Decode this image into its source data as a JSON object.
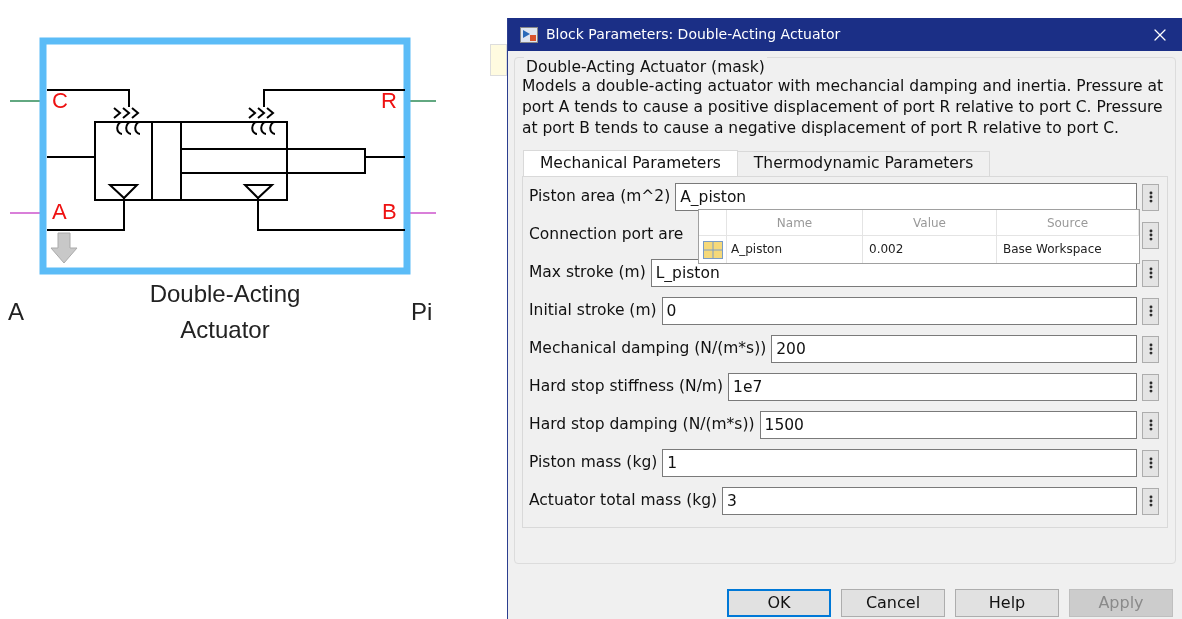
{
  "diagram": {
    "ports": [
      {
        "label": "C"
      },
      {
        "label": "R"
      },
      {
        "label": "A"
      },
      {
        "label": "B"
      }
    ],
    "block_label": "Double-Acting Actuator",
    "neighbor_labels": [
      "A",
      "Pi"
    ]
  },
  "dialog": {
    "title": "Block Parameters: Double-Acting Actuator",
    "group_title": "Double-Acting Actuator (mask)",
    "description": "Models a double-acting actuator with mechancial damping and inertia. Pressure at port A tends to cause a positive displacement of port R relative to port C. Pressure at port B tends to cause a negative displacement of port R relative to port C.",
    "tabs": [
      {
        "label": "Mechanical Parameters",
        "selected": true
      },
      {
        "label": "Thermodynamic Parameters",
        "selected": false
      }
    ],
    "parameters": [
      {
        "label": "Piston area (m^2)",
        "value": "A_piston"
      },
      {
        "label": "Connection port are"
      },
      {
        "label": "Max stroke (m)",
        "value": "L_piston"
      },
      {
        "label": "Initial stroke (m)",
        "value": "0"
      },
      {
        "label": "Mechanical damping (N/(m*s))",
        "value": "200"
      },
      {
        "label": "Hard stop stiffness (N/m)",
        "value": "1e7"
      },
      {
        "label": "Hard stop damping (N/(m*s))",
        "value": "1500"
      },
      {
        "label": "Piston mass (kg)",
        "value": "1"
      },
      {
        "label": "Actuator total mass (kg)",
        "value": "3"
      }
    ],
    "autocomplete": {
      "columns": [
        "Name",
        "Value",
        "Source"
      ],
      "rows": [
        {
          "name": "A_piston",
          "value": "0.002",
          "source": "Base Workspace"
        }
      ]
    },
    "buttons": [
      {
        "label": "OK",
        "focused": true,
        "disabled": false
      },
      {
        "label": "Cancel",
        "focused": false,
        "disabled": false
      },
      {
        "label": "Help",
        "focused": false,
        "disabled": false
      },
      {
        "label": "Apply",
        "focused": false,
        "disabled": true
      }
    ]
  }
}
